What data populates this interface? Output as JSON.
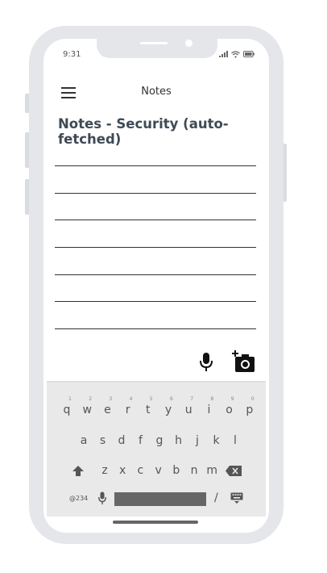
{
  "status_bar": {
    "time": "9:31"
  },
  "header": {
    "title": "Notes"
  },
  "page": {
    "title": "Notes - Security (auto-fetched)"
  },
  "keyboard": {
    "row1": [
      {
        "key": "q",
        "num": "1"
      },
      {
        "key": "w",
        "num": "2"
      },
      {
        "key": "e",
        "num": "3"
      },
      {
        "key": "r",
        "num": "4"
      },
      {
        "key": "t",
        "num": "5"
      },
      {
        "key": "y",
        "num": "6"
      },
      {
        "key": "u",
        "num": "7"
      },
      {
        "key": "i",
        "num": "8"
      },
      {
        "key": "o",
        "num": "9"
      },
      {
        "key": "p",
        "num": "0"
      }
    ],
    "row2": [
      "a",
      "s",
      "d",
      "f",
      "g",
      "h",
      "j",
      "k",
      "l"
    ],
    "row3": [
      "z",
      "x",
      "c",
      "v",
      "b",
      "n",
      "m"
    ],
    "symbols_key": "@234",
    "slash_key": "/"
  },
  "colors": {
    "frame": "#e4e6ea",
    "title": "#3e4a55",
    "keyboard_bg": "#e9e9e9"
  }
}
